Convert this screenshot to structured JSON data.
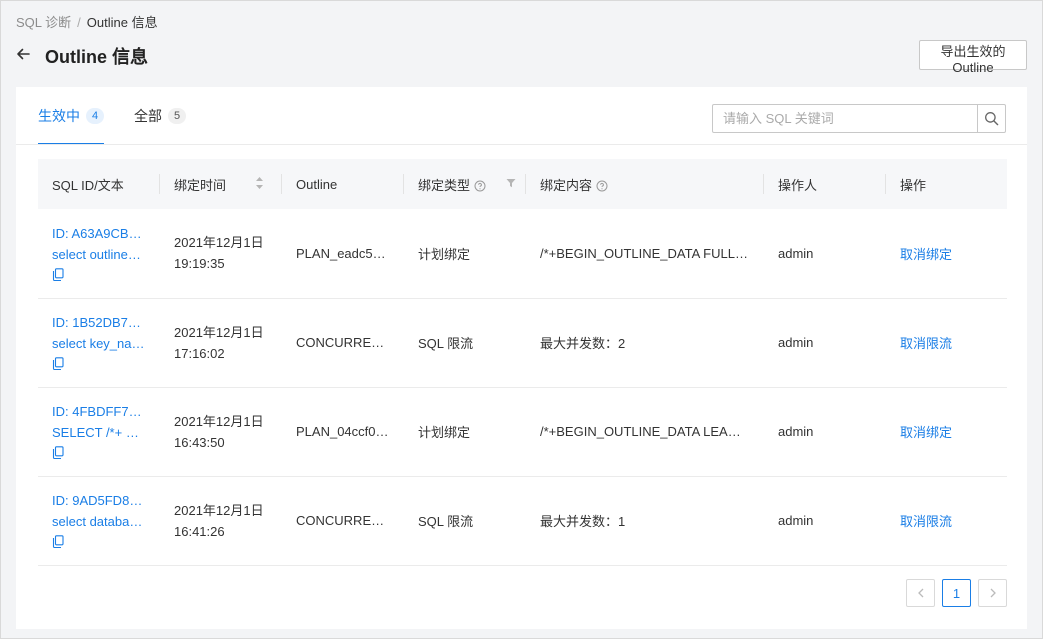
{
  "breadcrumb": {
    "parent": "SQL 诊断",
    "separator": "/",
    "current": "Outline 信息"
  },
  "header": {
    "title": "Outline 信息",
    "export_button": "导出生效的 Outline"
  },
  "tabs": [
    {
      "label": "生效中",
      "count": "4",
      "active": true
    },
    {
      "label": "全部",
      "count": "5",
      "active": false
    }
  ],
  "search": {
    "placeholder": "请输入 SQL 关键词"
  },
  "table": {
    "columns": [
      "SQL ID/文本",
      "绑定时间",
      "Outline",
      "绑定类型",
      "绑定内容",
      "操作人",
      "操作"
    ],
    "rows": [
      {
        "sql_id": "ID: A63A9CB4...",
        "sql_text": "select outline_na...",
        "date": "2021年12月1日",
        "time": "19:19:35",
        "outline": "PLAN_eadc536...",
        "type": "计划绑定",
        "content": "/*+BEGIN_OUTLINE_DATA FULL(@\"...",
        "operator": "admin",
        "action": "取消绑定"
      },
      {
        "sql_id": "ID: 1B52DB7AE...",
        "sql_text": "select key_name ...",
        "date": "2021年12月1日",
        "time": "17:16:02",
        "outline": "CONCURRENT...",
        "type": "SQL 限流",
        "content": "最大并发数：2",
        "operator": "admin",
        "action": "取消限流"
      },
      {
        "sql_id": "ID: 4FBDFF77F...",
        "sql_text": "SELECT /*+ READ...",
        "date": "2021年12月1日",
        "time": "16:43:50",
        "outline": "PLAN_04ccf04...",
        "type": "计划绑定",
        "content": "/*+BEGIN_OUTLINE_DATA LEADING...",
        "operator": "admin",
        "action": "取消绑定"
      },
      {
        "sql_id": "ID: 9AD5FD89...",
        "sql_text": "select database_i...",
        "date": "2021年12月1日",
        "time": "16:41:26",
        "outline": "CONCURRENT...",
        "type": "SQL 限流",
        "content": "最大并发数：1",
        "operator": "admin",
        "action": "取消限流"
      }
    ]
  },
  "pagination": {
    "current_page": "1"
  },
  "colors": {
    "accent": "#1a7ee6",
    "background": "#f3f4f6",
    "header_bg": "#f6f7f9"
  }
}
